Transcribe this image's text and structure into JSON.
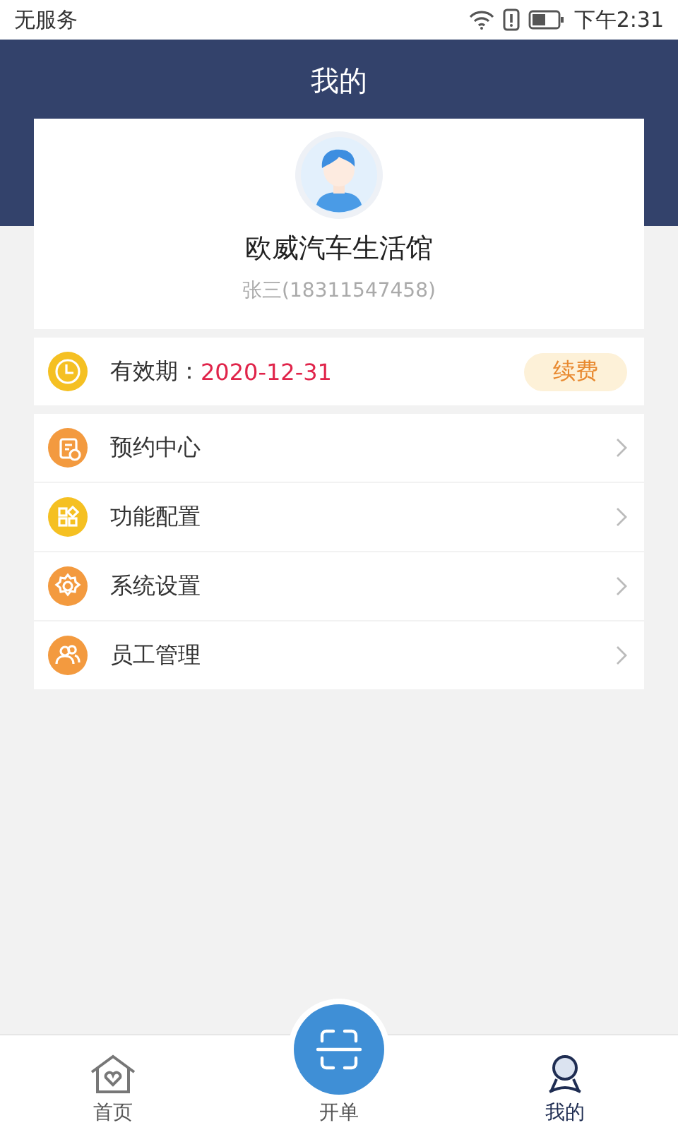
{
  "status_bar": {
    "carrier": "无服务",
    "time": "下午2:31"
  },
  "header": {
    "title": "我的"
  },
  "profile": {
    "store_name": "欧威汽车生活馆",
    "user": "张三(18311547458)"
  },
  "validity": {
    "label": "有效期：",
    "date": "2020-12-31",
    "button": "续费"
  },
  "menu": [
    {
      "label": "预约中心",
      "kind": "calendar",
      "color": "#f39a3f"
    },
    {
      "label": "功能配置",
      "kind": "grid",
      "color": "#f5c022"
    },
    {
      "label": "系统设置",
      "kind": "gear",
      "color": "#f39a3f"
    },
    {
      "label": "员工管理",
      "kind": "users",
      "color": "#f39a3f"
    }
  ],
  "tabs": [
    {
      "kind": "home",
      "label": "首页",
      "selected": false
    },
    {
      "kind": "scan",
      "label": "开单",
      "selected": false
    },
    {
      "kind": "profile",
      "label": "我的",
      "selected": true
    }
  ]
}
